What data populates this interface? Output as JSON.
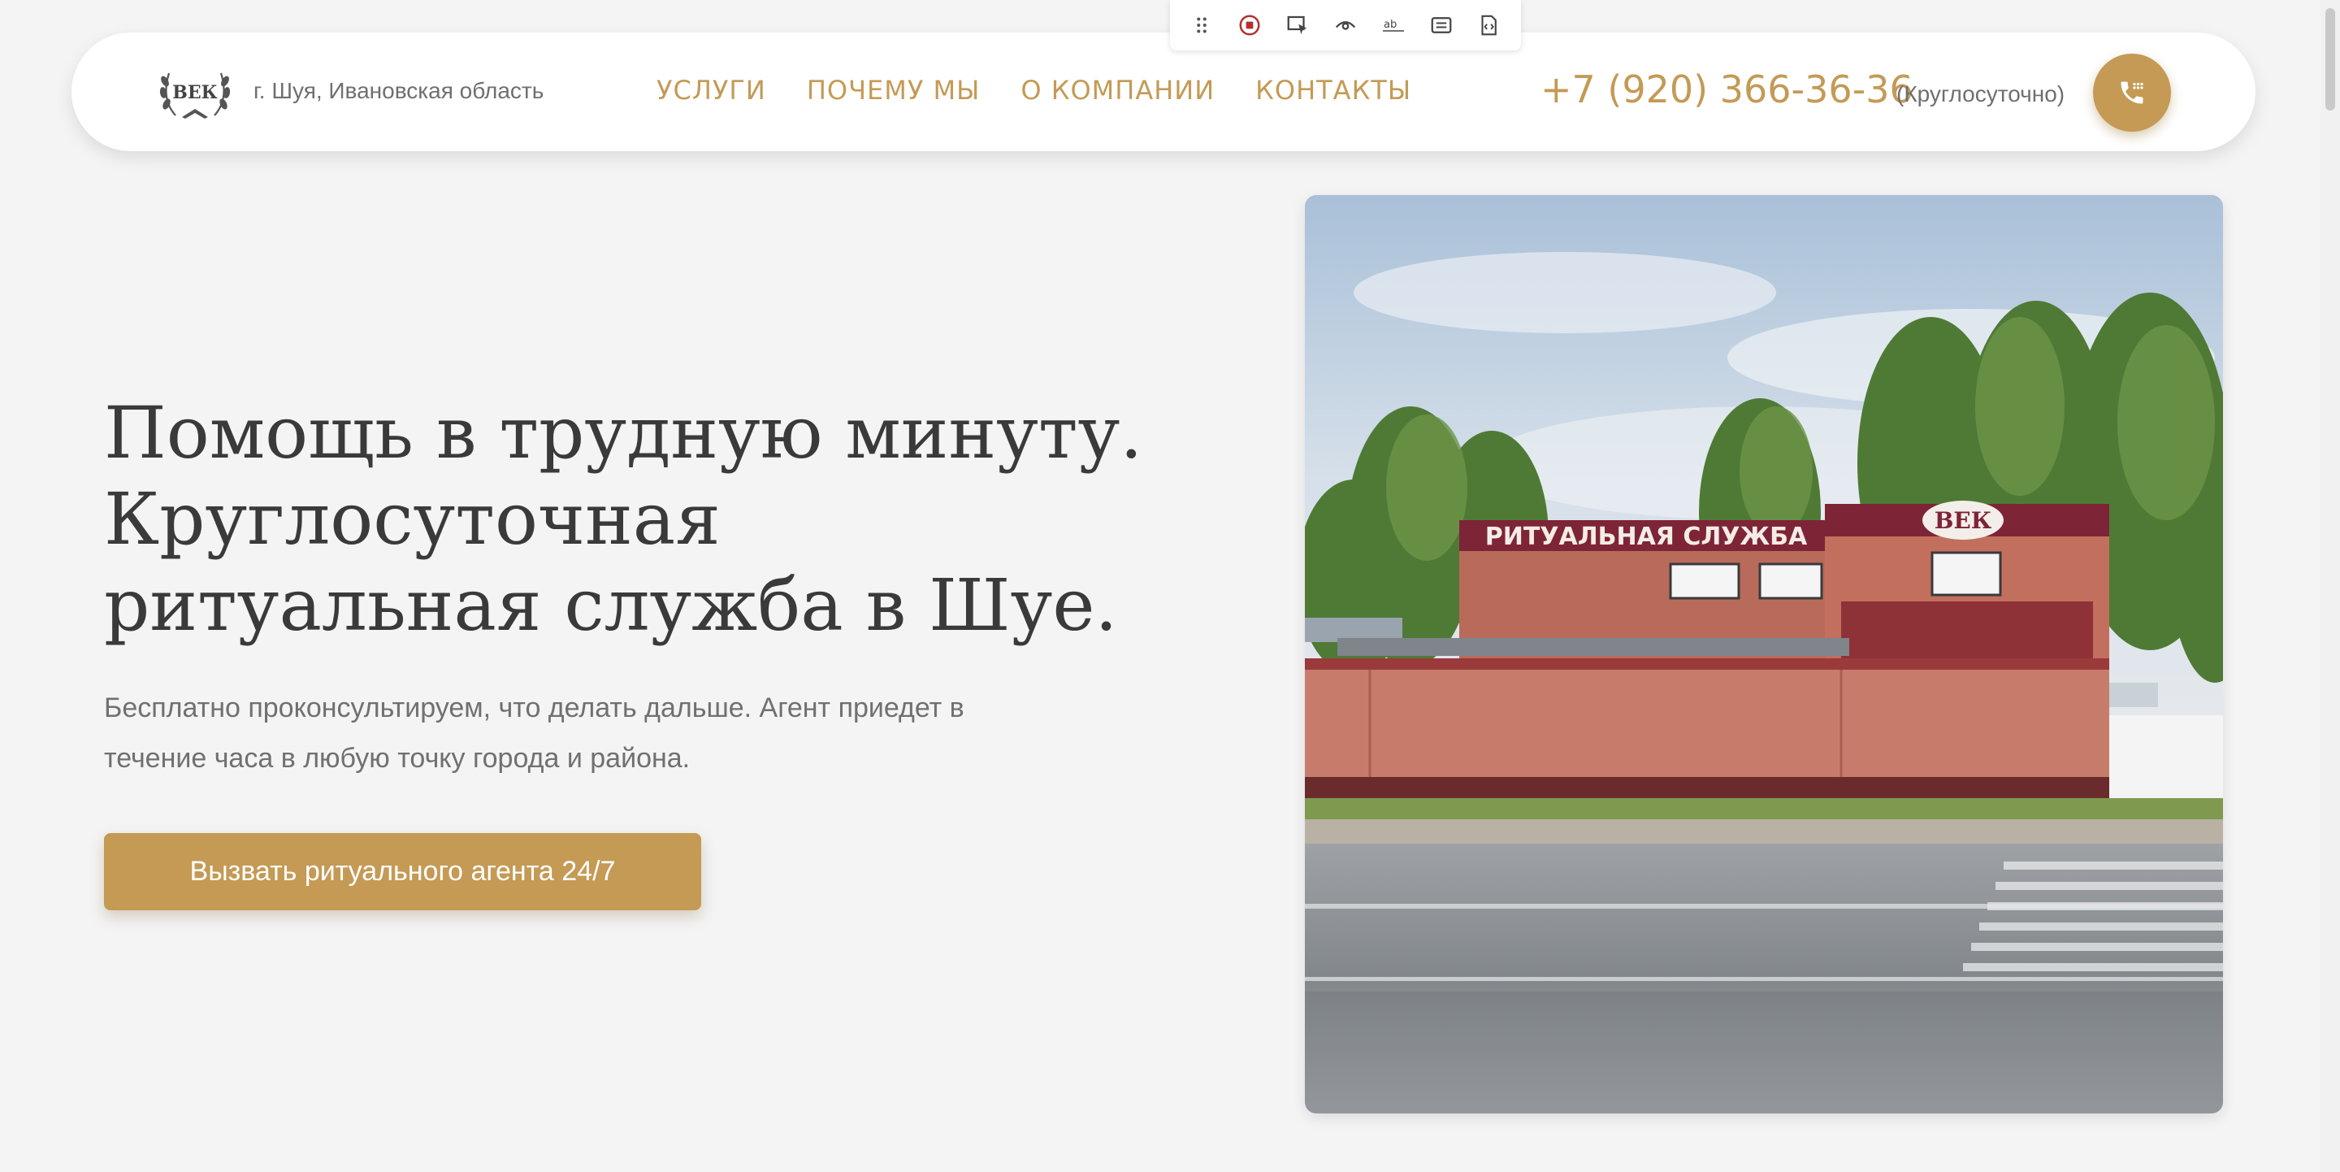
{
  "toolbar": {
    "tools": [
      {
        "icon": "drag-handle-icon"
      },
      {
        "icon": "record-icon"
      },
      {
        "icon": "select-element-icon"
      },
      {
        "icon": "preview-icon"
      },
      {
        "icon": "text-edit-icon"
      },
      {
        "icon": "comment-icon"
      },
      {
        "icon": "code-icon"
      }
    ]
  },
  "header": {
    "logo_text": "ВЕК",
    "city": "г. Шуя, Ивановская область",
    "nav": [
      "УСЛУГИ",
      "ПОЧЕМУ МЫ",
      "О КОМПАНИИ",
      "КОНТАКТЫ"
    ],
    "phone": "+7 (920) 366-36-36",
    "hours": "(Круглосуточно)"
  },
  "hero": {
    "title_lines": [
      "Помощь в трудную минуту.",
      "Круглосуточная",
      "ритуальная служба в Шуе."
    ],
    "subtitle": "Бесплатно проконсультируем, что делать дальше. Агент приедет в течение часа в любую точку города и района.",
    "cta_label": "Вызвать ритуального агента 24/7"
  },
  "photo": {
    "sign_text": "РИТУАЛЬНАЯ СЛУЖБА",
    "badge_text": "ВЕК"
  },
  "colors": {
    "accent": "#c49a55",
    "background": "#f4f4f4",
    "text": "#3a3a3a",
    "muted": "#707070"
  }
}
